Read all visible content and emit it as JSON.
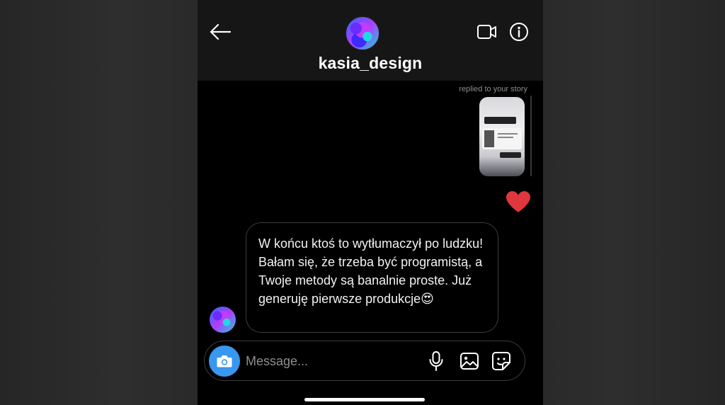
{
  "header": {
    "username": "kasia_design",
    "back_icon": "arrow-left-icon",
    "video_icon": "video-camera-icon",
    "info_icon": "info-icon"
  },
  "story_reply": {
    "caption": "replied to your story"
  },
  "reaction": {
    "icon": "heart-icon",
    "color": "#e0363e"
  },
  "message": {
    "text": "W końcu ktoś to wytłumaczył po ludzku! Bałam się, że trzeba być programistą, a Twoje metody są banalnie proste. Już generuję pierwsze produkcje😍"
  },
  "composer": {
    "placeholder": "Message...",
    "camera_icon": "camera-icon",
    "mic_icon": "microphone-icon",
    "gallery_icon": "image-icon",
    "sticker_icon": "sticker-icon",
    "accent": "#3897f0"
  }
}
